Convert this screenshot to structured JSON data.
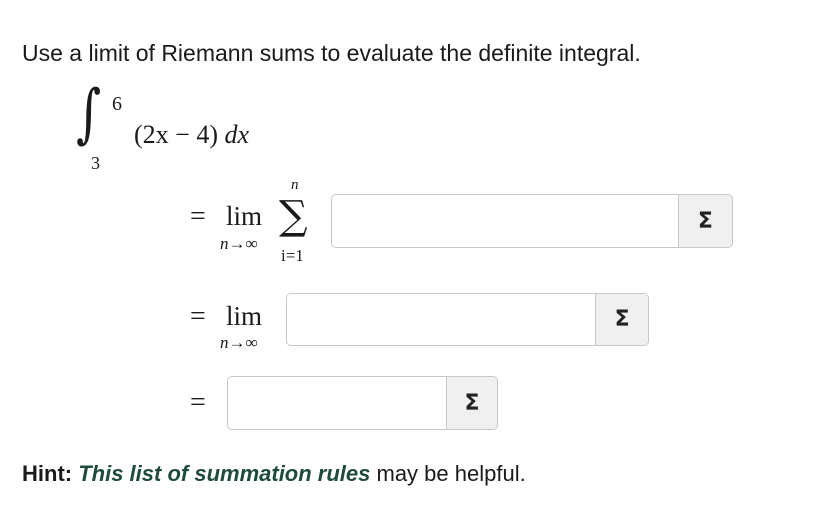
{
  "question": {
    "instruction": "Use a limit of Riemann sums to evaluate the definite integral."
  },
  "integral": {
    "sign": "∫",
    "upper": "6",
    "lower": "3",
    "integrand": "(2x − 4)",
    "differential": "dx"
  },
  "steps": [
    {
      "equals": "=",
      "lim": "lim",
      "lim_sub": "n→∞",
      "sigma": "∑",
      "sum_top": "n",
      "sum_bottom": "i=1",
      "input_value": "",
      "button_label": "Σ"
    },
    {
      "equals": "=",
      "lim": "lim",
      "lim_sub": "n→∞",
      "input_value": "",
      "button_label": "Σ"
    },
    {
      "equals": "=",
      "input_value": "",
      "button_label": "Σ"
    }
  ],
  "hint": {
    "label": "Hint:",
    "link_text": "This list of summation rules",
    "suffix": "may be helpful."
  },
  "colors": {
    "link": "#1e4b3c",
    "border": "#c8c8c8",
    "button_bg": "#f0f0f0"
  }
}
